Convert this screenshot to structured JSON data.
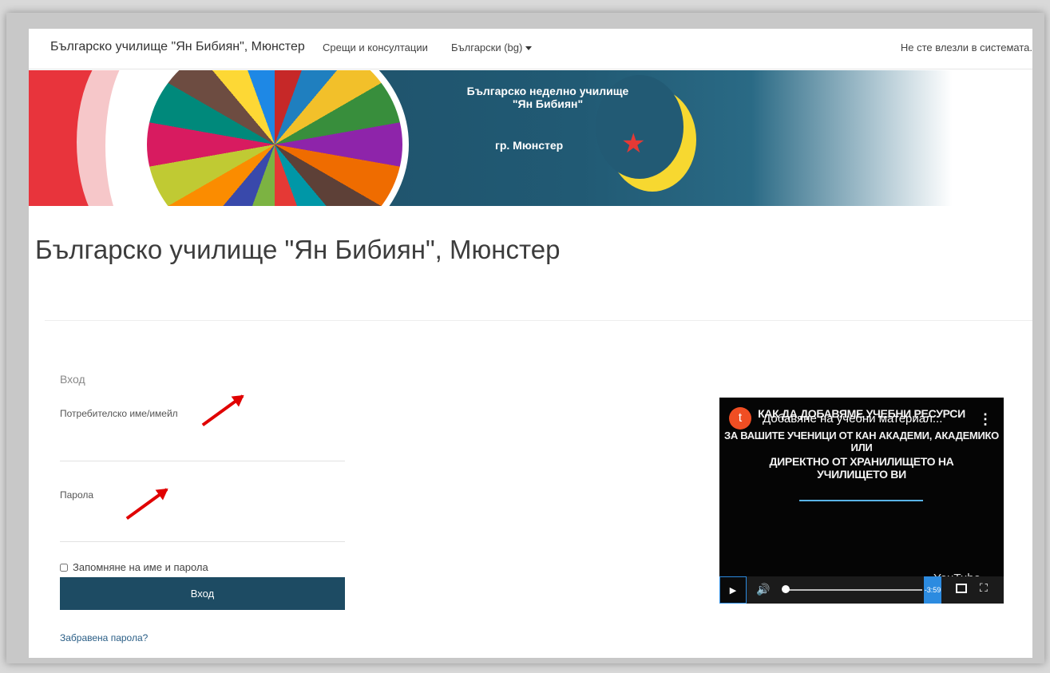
{
  "navbar": {
    "brand": "Българско училище \"Ян Бибиян\", Мюнстер",
    "links": [
      {
        "label": "Срещи и консултации"
      },
      {
        "label": "Български (bg)"
      }
    ],
    "login_status": "Не сте влезли в системата."
  },
  "banner": {
    "line1": "Българско неделно училище",
    "line2": "\"Ян Бибиян\"",
    "city": "гр. Мюнстер"
  },
  "page_title": "Българско училище \"Ян Бибиян\", Мюнстер",
  "login": {
    "heading": "Вход",
    "username_label": "Потребителско име/имейл",
    "username_value": "",
    "password_label": "Парола",
    "password_value": "",
    "remember_label": "Запомняне на име и парола",
    "submit_label": "Вход",
    "forgot_label": "Забравена парола?"
  },
  "video": {
    "channel_initial": "t",
    "title": "Добавяне на учебни материал...",
    "heading_lines": [
      "КАК ДА ДОБАВЯМЕ УЧЕБНИ РЕСУРСИ",
      "ЗА ВАШИТЕ УЧЕНИЦИ ОТ КАН АКАДЕМИ, АКАДЕМИКО ИЛИ",
      "ДИРЕКТНО ОТ ХРАНИЛИЩЕТО НА",
      "УЧИЛИЩЕТО ВИ"
    ],
    "time_remaining": "-3:59",
    "logo": "YouTube"
  },
  "colors": {
    "primary": "#1d4b63",
    "annotation_arrow": "#e00000",
    "player_accent": "#2c8be0"
  }
}
